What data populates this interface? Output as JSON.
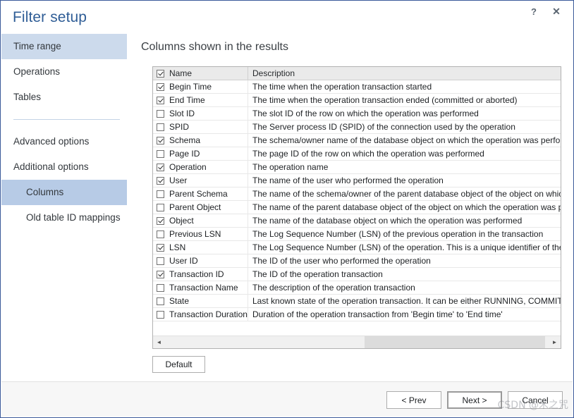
{
  "window": {
    "title": "Filter setup",
    "help_icon": "question-mark-icon",
    "help_label": "?",
    "close_icon": "close-icon",
    "close_label": "✕"
  },
  "sidebar": {
    "items": [
      {
        "label": "Time range",
        "state": "active-light",
        "level": "top"
      },
      {
        "label": "Operations",
        "state": "normal",
        "level": "top"
      },
      {
        "label": "Tables",
        "state": "normal",
        "level": "top"
      },
      {
        "label": "Advanced options",
        "state": "normal",
        "level": "top"
      },
      {
        "label": "Additional options",
        "state": "normal",
        "level": "top"
      },
      {
        "label": "Columns",
        "state": "active",
        "level": "sub"
      },
      {
        "label": "Old table ID mappings",
        "state": "normal",
        "level": "sub"
      }
    ]
  },
  "main": {
    "heading": "Columns shown in the results",
    "grid": {
      "columns": [
        "Name",
        "Description"
      ],
      "header_checkbox_checked": true,
      "rows": [
        {
          "checked": true,
          "name": "Begin Time",
          "description": "The time when the operation transaction started"
        },
        {
          "checked": true,
          "name": "End Time",
          "description": "The time when the operation transaction ended (committed or aborted)"
        },
        {
          "checked": false,
          "name": "Slot ID",
          "description": "The slot ID of the row on which the operation was performed"
        },
        {
          "checked": false,
          "name": "SPID",
          "description": "The Server process ID (SPID) of the connection used by the operation"
        },
        {
          "checked": true,
          "name": "Schema",
          "description": "The schema/owner name of the database object on which the operation was performed"
        },
        {
          "checked": false,
          "name": "Page ID",
          "description": "The page ID of the row on which the operation was performed"
        },
        {
          "checked": true,
          "name": "Operation",
          "description": "The operation name"
        },
        {
          "checked": true,
          "name": "User",
          "description": "The name of the user who performed the operation"
        },
        {
          "checked": false,
          "name": "Parent Schema",
          "description": "The name of the schema/owner of the parent database object of the object on which the o"
        },
        {
          "checked": false,
          "name": "Parent Object",
          "description": "The name of the parent database object of the object on which the operation was performe"
        },
        {
          "checked": true,
          "name": "Object",
          "description": "The name of the database object on which the operation was performed"
        },
        {
          "checked": false,
          "name": "Previous LSN",
          "description": "The Log Sequence Number (LSN) of the previous operation in the transaction"
        },
        {
          "checked": true,
          "name": "LSN",
          "description": "The Log Sequence Number (LSN) of the operation. This is a unique identifier of the operat"
        },
        {
          "checked": false,
          "name": "User ID",
          "description": "The ID of the user who performed the operation"
        },
        {
          "checked": true,
          "name": "Transaction ID",
          "description": "The ID of the operation transaction"
        },
        {
          "checked": false,
          "name": "Transaction Name",
          "description": "The description of the operation transaction"
        },
        {
          "checked": false,
          "name": "State",
          "description": "Last known state of the operation transaction. It can be either RUNNING, COMMITTED, A"
        },
        {
          "checked": false,
          "name": "Transaction Duration",
          "description": "Duration of the operation transaction from 'Begin time' to 'End time'"
        }
      ],
      "hscroll": {
        "left_arrow": "◄",
        "right_arrow": "►"
      }
    },
    "default_button": "Default"
  },
  "footer": {
    "prev_label": "< Prev",
    "next_label": "Next >",
    "cancel_label": "Cancel"
  },
  "watermark": "CSDN @禾之咒",
  "colors": {
    "title_blue": "#2f5d96",
    "nav_active": "#b7cbe6",
    "nav_active_light": "#ccdaec",
    "window_border": "#3b5a9a",
    "grid_header_bg": "#eaeaea"
  }
}
